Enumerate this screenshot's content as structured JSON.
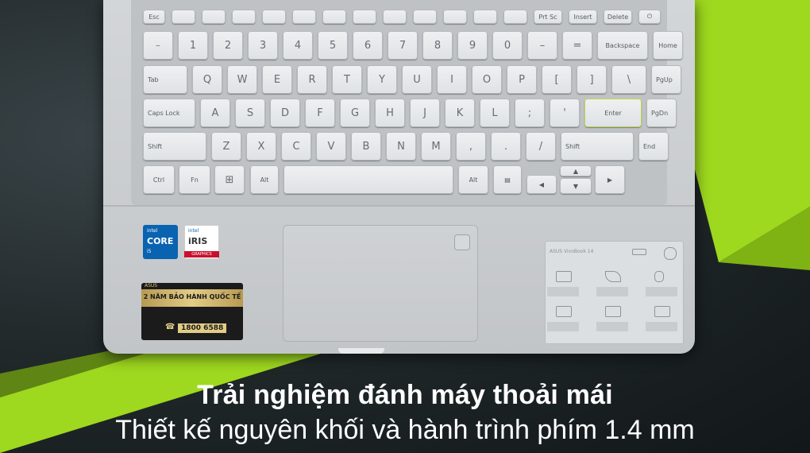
{
  "colors": {
    "accent_green": "#9ed81f",
    "background": "#1d2426",
    "text": "#ffffff"
  },
  "keyboard": {
    "fn_row": [
      "Esc",
      "",
      "",
      "",
      "",
      "",
      "",
      "",
      "",
      "",
      "",
      "",
      "",
      "Prt Sc",
      "Insert",
      "Delete",
      "⏻"
    ],
    "num_row": [
      "~",
      "1",
      "2",
      "3",
      "4",
      "5",
      "6",
      "7",
      "8",
      "9",
      "0",
      "–",
      "=",
      "Backspace",
      "Home"
    ],
    "q_row": [
      "Tab",
      "Q",
      "W",
      "E",
      "R",
      "T",
      "Y",
      "U",
      "I",
      "O",
      "P",
      "[",
      "]",
      "\\",
      "PgUp"
    ],
    "a_row": [
      "Caps Lock",
      "A",
      "S",
      "D",
      "F",
      "G",
      "H",
      "J",
      "K",
      "L",
      ";",
      "'",
      "Enter",
      "PgDn"
    ],
    "z_row": [
      "Shift",
      "Z",
      "X",
      "C",
      "V",
      "B",
      "N",
      "M",
      ",",
      ".",
      "/",
      "Shift",
      "End"
    ],
    "bottom_row": [
      "Ctrl",
      "Fn",
      "⊞",
      "Alt",
      "",
      "Alt",
      "▤",
      "◀",
      "▲",
      "▼",
      "▶"
    ]
  },
  "stickers": {
    "intel_core": {
      "brand": "intel",
      "name": "CORE",
      "tier": "i5"
    },
    "intel_iris": {
      "brand": "intel",
      "name": "iRIS",
      "sub": "GRAPHICS"
    },
    "warranty": {
      "brand": "ASUS",
      "title": "2 NĂM BẢO HÀNH QUỐC TẾ",
      "phone": "1800 6588"
    },
    "spec_label": {
      "title": "ASUS VivoBook 14"
    }
  },
  "caption": {
    "headline": "Trải nghiệm đánh máy thoải mái",
    "subline": "Thiết kế nguyên khối và hành trình phím 1.4 mm"
  }
}
